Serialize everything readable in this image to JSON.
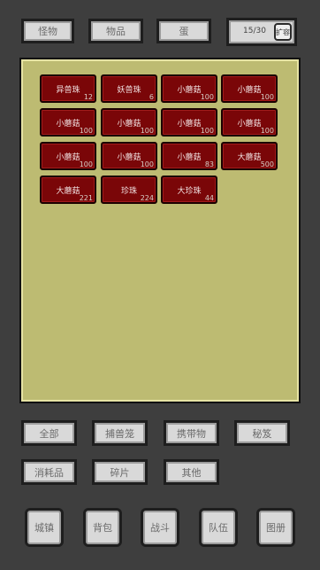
{
  "top_tabs": [
    {
      "label": "怪物"
    },
    {
      "label": "物品"
    },
    {
      "label": "蛋"
    }
  ],
  "capacity": {
    "count": "15/30",
    "expand_label": "扩容"
  },
  "items": [
    {
      "name": "异兽珠",
      "qty": "12"
    },
    {
      "name": "妖兽珠",
      "qty": "6"
    },
    {
      "name": "小蘑菇",
      "qty": "100"
    },
    {
      "name": "小蘑菇",
      "qty": "100"
    },
    {
      "name": "小蘑菇",
      "qty": "100"
    },
    {
      "name": "小蘑菇",
      "qty": "100"
    },
    {
      "name": "小蘑菇",
      "qty": "100"
    },
    {
      "name": "小蘑菇",
      "qty": "100"
    },
    {
      "name": "小蘑菇",
      "qty": "100"
    },
    {
      "name": "小蘑菇",
      "qty": "100"
    },
    {
      "name": "小蘑菇",
      "qty": "83"
    },
    {
      "name": "大蘑菇",
      "qty": "500"
    },
    {
      "name": "大蘑菇",
      "qty": "221"
    },
    {
      "name": "珍珠",
      "qty": "224"
    },
    {
      "name": "大珍珠",
      "qty": "44"
    }
  ],
  "filters": [
    {
      "label": "全部"
    },
    {
      "label": "捕兽笼"
    },
    {
      "label": "携带物"
    },
    {
      "label": "秘笈"
    },
    {
      "label": "消耗品"
    },
    {
      "label": "碎片"
    },
    {
      "label": "其他"
    }
  ],
  "bottom_nav": [
    {
      "label": "城镇"
    },
    {
      "label": "背包"
    },
    {
      "label": "战斗"
    },
    {
      "label": "队伍"
    },
    {
      "label": "图册"
    }
  ]
}
